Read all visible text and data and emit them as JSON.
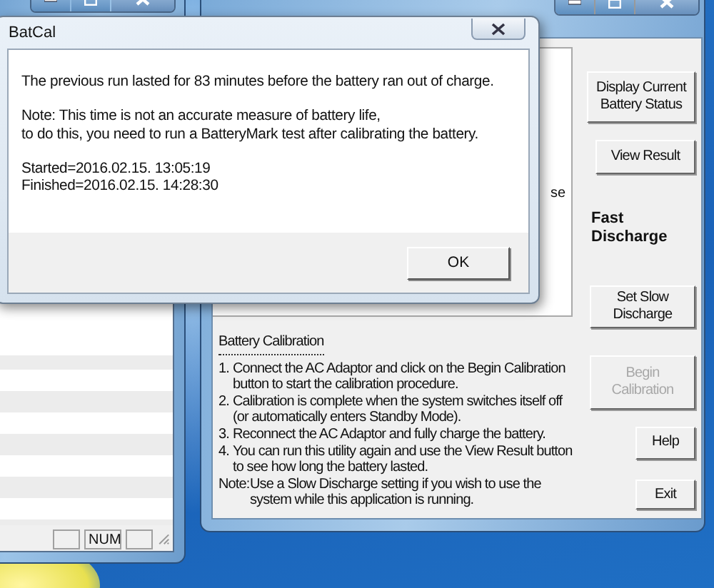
{
  "background_window": {
    "status_bar": {
      "indicator": "NUM"
    }
  },
  "main_window": {
    "group_text": "se",
    "side_items": [
      {
        "kind": "button",
        "label": "Display Current Battery Status",
        "disabled": false
      },
      {
        "kind": "button",
        "label": "View Result",
        "disabled": false
      },
      {
        "kind": "label",
        "label": "Fast Discharge"
      },
      {
        "kind": "button",
        "label": "Set Slow Discharge",
        "disabled": false
      },
      {
        "kind": "button",
        "label": "Begin Calibration",
        "disabled": true
      },
      {
        "kind": "button",
        "label": "Help",
        "disabled": false
      },
      {
        "kind": "button",
        "label": "Exit",
        "disabled": false
      }
    ],
    "instructions": {
      "title": "Battery Calibration",
      "steps": [
        {
          "number": "1.",
          "text": "Connect the AC Adaptor and click on the Begin Calibration button to start the calibration procedure."
        },
        {
          "number": "2.",
          "text": "Calibration is complete when the system switches itself off (or automatically enters Standby Mode)."
        },
        {
          "number": "3.",
          "text": "Reconnect the AC Adaptor and fully charge the battery."
        },
        {
          "number": "4.",
          "text": "You can run this utility again and use the View Result button to see how long the battery lasted."
        }
      ],
      "note": {
        "label": "Note:",
        "text": "Use a Slow Discharge setting if you wish to use the system while this application is running."
      }
    }
  },
  "dialog": {
    "title": "BatCal",
    "message": "The previous run lasted for 83 minutes before the battery ran out of charge.",
    "note_lines": [
      "Note: This time is not an accurate measure of battery life,",
      "to do this, you need to run a BatteryMark test after calibrating the battery."
    ],
    "times": [
      "Started=2016.02.15. 13:05:19",
      "Finished=2016.02.15. 14:28:30"
    ],
    "ok_button": "OK"
  }
}
